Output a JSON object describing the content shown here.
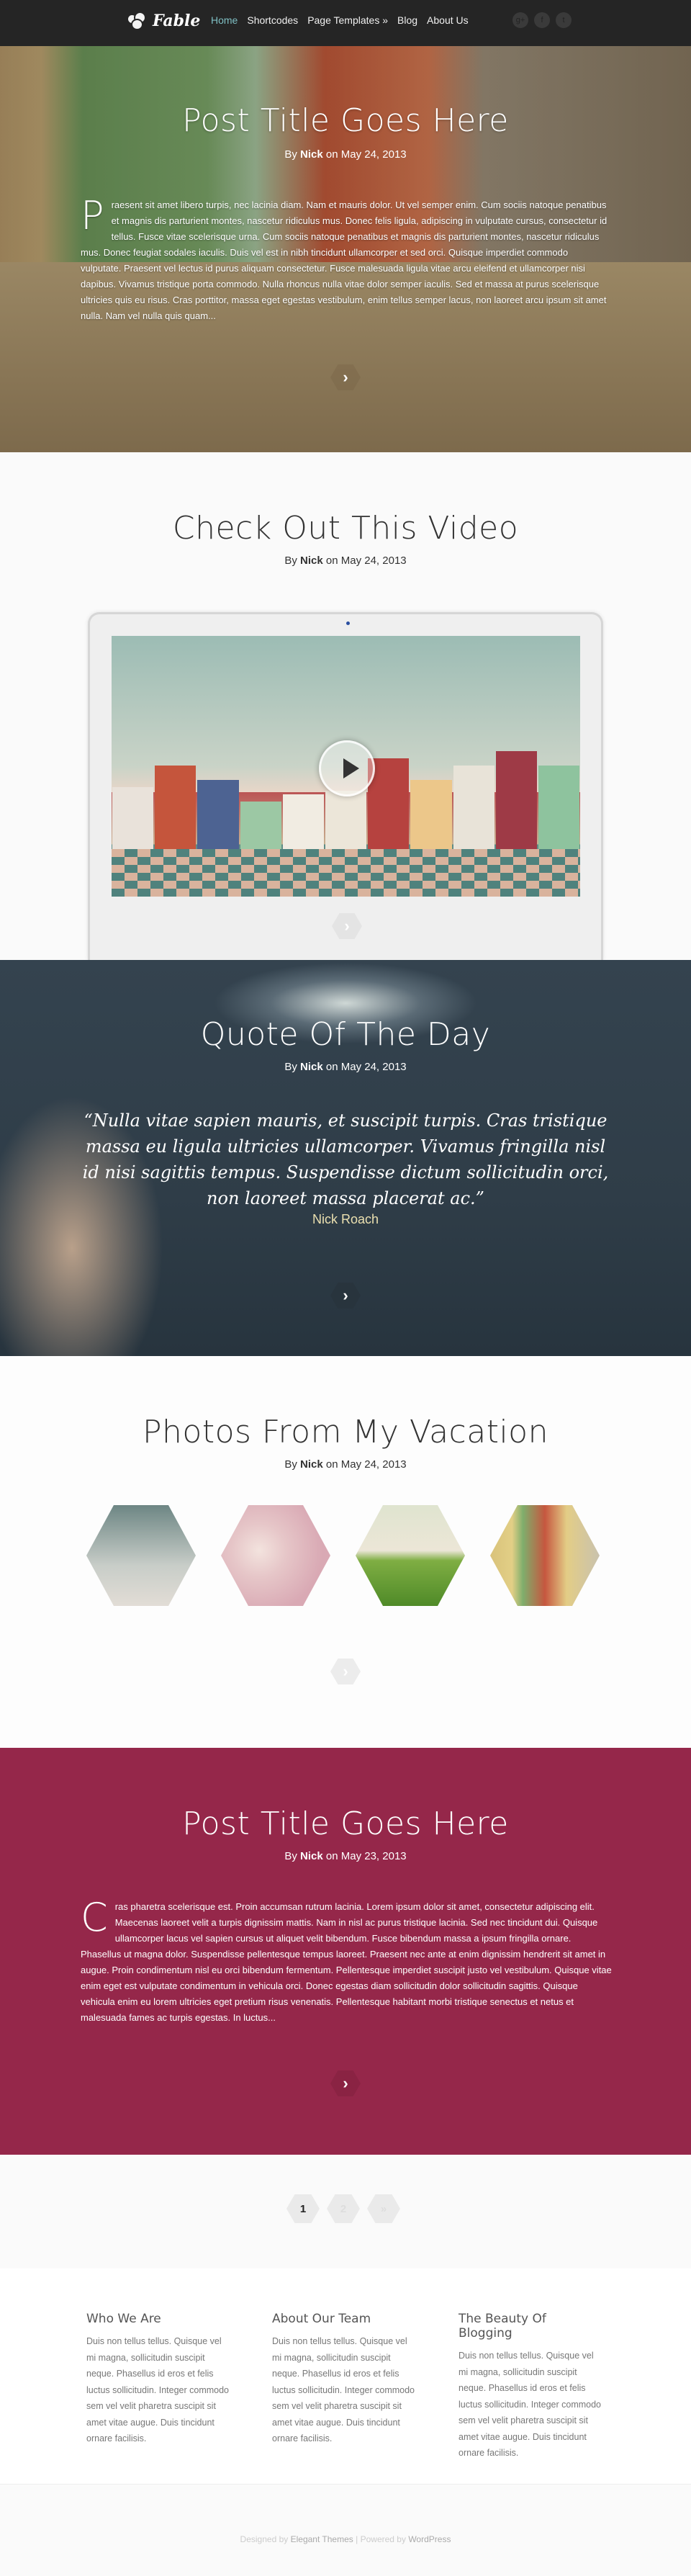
{
  "header": {
    "logo_text": "Fable",
    "nav": [
      {
        "label": "Home",
        "active": true
      },
      {
        "label": "Shortcodes"
      },
      {
        "label": "Page Templates »"
      },
      {
        "label": "Blog"
      },
      {
        "label": "About Us"
      }
    ],
    "social": [
      {
        "name": "google-plus",
        "glyph": "g+"
      },
      {
        "name": "facebook",
        "glyph": "f"
      },
      {
        "name": "twitter",
        "glyph": "t"
      }
    ]
  },
  "posts": {
    "hero": {
      "title": "Post Title Goes Here",
      "by": "By",
      "author": "Nick",
      "on": "on May 24, 2013",
      "dropcap": "P",
      "excerpt": "raesent sit amet libero turpis, nec lacinia diam. Nam et mauris dolor. Ut vel semper enim. Cum sociis natoque penatibus et magnis dis parturient montes, nascetur ridiculus mus. Donec felis ligula, adipiscing in vulputate cursus, consectetur id tellus. Fusce vitae scelerisque urna. Cum sociis natoque penatibus et magnis dis parturient montes, nascetur ridiculus mus. Donec feugiat sodales iaculis. Duis vel est in nibh tincidunt ullamcorper et sed orci. Quisque imperdiet commodo vulputate. Praesent vel lectus id purus aliquam consectetur. Fusce malesuada ligula vitae arcu eleifend et ullamcorper nisi dapibus. Vivamus tristique porta commodo. Nulla rhoncus nulla vitae dolor semper iaculis. Sed et massa at purus scelerisque ultricies quis eu risus. Cras porttitor, massa eget egestas vestibulum, enim tellus semper lacus, non laoreet arcu ipsum sit amet nulla. Nam vel nulla quis quam..."
    },
    "video": {
      "title": "Check Out This Video",
      "by": "By",
      "author": "Nick",
      "on": "on May 24, 2013"
    },
    "quote": {
      "title": "Quote Of The Day",
      "by": "By",
      "author": "Nick",
      "on": "on May 24, 2013",
      "text": "“Nulla vitae sapien mauris, et suscipit turpis. Cras tristique massa eu ligula ultricies ullamcorper. Vivamus fringilla nisl id nisi sagittis tempus. Suspendisse dictum sollicitudin orci, non laoreet massa placerat ac.”",
      "cite": "Nick Roach"
    },
    "gallery": {
      "title": "Photos From My Vacation",
      "by": "By",
      "author": "Nick",
      "on": "on May 24, 2013",
      "photos": [
        "bare-tree-sky",
        "bunny-girls",
        "green-hill-house",
        "colorful-houses"
      ]
    },
    "post2": {
      "title": "Post Title Goes Here",
      "by": "By",
      "author": "Nick",
      "on": "on May 23, 2013",
      "dropcap": "C",
      "excerpt": "ras pharetra scelerisque est. Proin accumsan rutrum lacinia. Lorem ipsum dolor sit amet, consectetur adipiscing elit. Maecenas laoreet velit a turpis dignissim mattis. Nam in nisl ac purus tristique lacinia. Sed nec tincidunt dui. Quisque ullamcorper lacus vel sapien cursus ut aliquet velit bibendum. Fusce bibendum massa a ipsum fringilla ornare. Phasellus ut magna dolor. Suspendisse pellentesque tempus laoreet. Praesent nec ante at enim dignissim hendrerit sit amet in augue. Proin condimentum nisl eu orci bibendum fermentum. Pellentesque imperdiet suscipit justo vel vestibulum. Quisque vitae enim eget est vulputate condimentum in vehicula orci. Donec egestas diam sollicitudin dolor sollicitudin sagittis. Quisque vehicula enim eu lorem ultricies eget pretium risus venenatis. Pellentesque habitant morbi tristique senectus et netus et malesuada fames ac turpis egestas. In luctus..."
    },
    "more_glyph": "›"
  },
  "pagination": {
    "pages": [
      "1",
      "2"
    ],
    "next": "»",
    "current": "1"
  },
  "footer": {
    "widgets": [
      {
        "title": "Who We Are",
        "text": "Duis non tellus tellus. Quisque vel mi magna, sollicitudin suscipit neque. Phasellus id eros et felis luctus sollicitudin. Integer commodo sem vel velit pharetra suscipit sit amet vitae augue. Duis tincidunt ornare facilisis."
      },
      {
        "title": "About Our Team",
        "text": "Duis non tellus tellus. Quisque vel mi magna, sollicitudin suscipit neque. Phasellus id eros et felis luctus sollicitudin. Integer commodo sem vel velit pharetra suscipit sit amet vitae augue. Duis tincidunt ornare facilisis."
      },
      {
        "title": "The Beauty Of Blogging",
        "text": "Duis non tellus tellus. Quisque vel mi magna, sollicitudin suscipit neque. Phasellus id eros et felis luctus sollicitudin. Integer commodo sem vel velit pharetra suscipit sit amet vitae augue. Duis tincidunt ornare facilisis."
      }
    ],
    "credits": {
      "designed_by": "Designed by",
      "designer": "Elegant Themes",
      "sep": "|",
      "powered_by": "Powered by",
      "platform": "WordPress"
    }
  },
  "colors": {
    "header_bg": "#252525",
    "nav_active": "#7fbfc3",
    "accent_post": "#95274a",
    "quote_cite": "#ebe0b0"
  }
}
